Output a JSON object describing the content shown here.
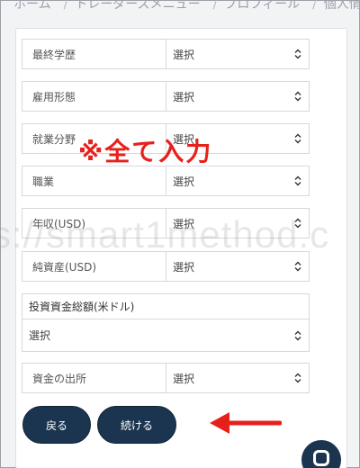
{
  "breadcrumb": {
    "items": [
      "ホーム",
      "トレーダーズメニュー",
      "プロフィール",
      "個人情"
    ]
  },
  "form": {
    "rows": [
      {
        "label": "最終学歴",
        "value": "選択"
      },
      {
        "label": "雇用形態",
        "value": "選択"
      },
      {
        "label": "就業分野",
        "value": "選択"
      },
      {
        "label": "職業",
        "value": "選択"
      },
      {
        "label": "年収(USD)",
        "value": "選択"
      },
      {
        "label": "純資産(USD)",
        "value": "選択"
      },
      {
        "label": "資金の出所",
        "value": "選択"
      }
    ],
    "investment": {
      "label": "投資資金総額(米ドル)",
      "value": "選択"
    }
  },
  "buttons": {
    "back": "戻る",
    "next": "続ける"
  },
  "annotation": {
    "text": "※全て入力",
    "color": "#e8201c"
  },
  "watermark": "s://smart1method.c",
  "colors": {
    "button": "#1b3550",
    "annotation": "#e8201c"
  },
  "icons": {
    "select_caret": "up-down-caret-icon",
    "chat": "chat-icon",
    "arrow": "left-arrow-icon"
  }
}
